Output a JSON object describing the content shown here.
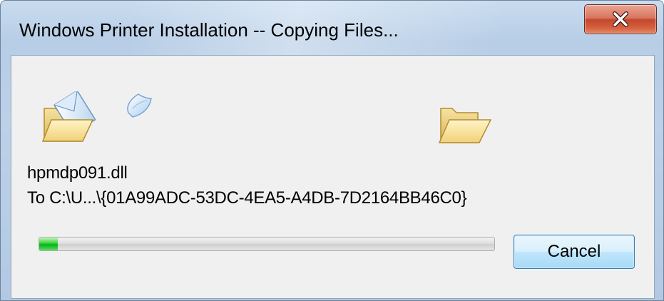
{
  "window": {
    "title": "Windows Printer Installation -- Copying Files...",
    "close_label": "X"
  },
  "copy": {
    "file_name": "hpmdp091.dll",
    "destination": "To C:\\U...\\{01A99ADC-53DC-4EA5-A4DB-7D2164BB46C0}"
  },
  "progress": {
    "fraction": 0.04,
    "fill_color": "#06b025"
  },
  "buttons": {
    "cancel_label": "Cancel"
  },
  "icons": {
    "source": "open-folder-with-page-icon",
    "flying": "flying-document-icon",
    "destination": "open-folder-icon"
  }
}
